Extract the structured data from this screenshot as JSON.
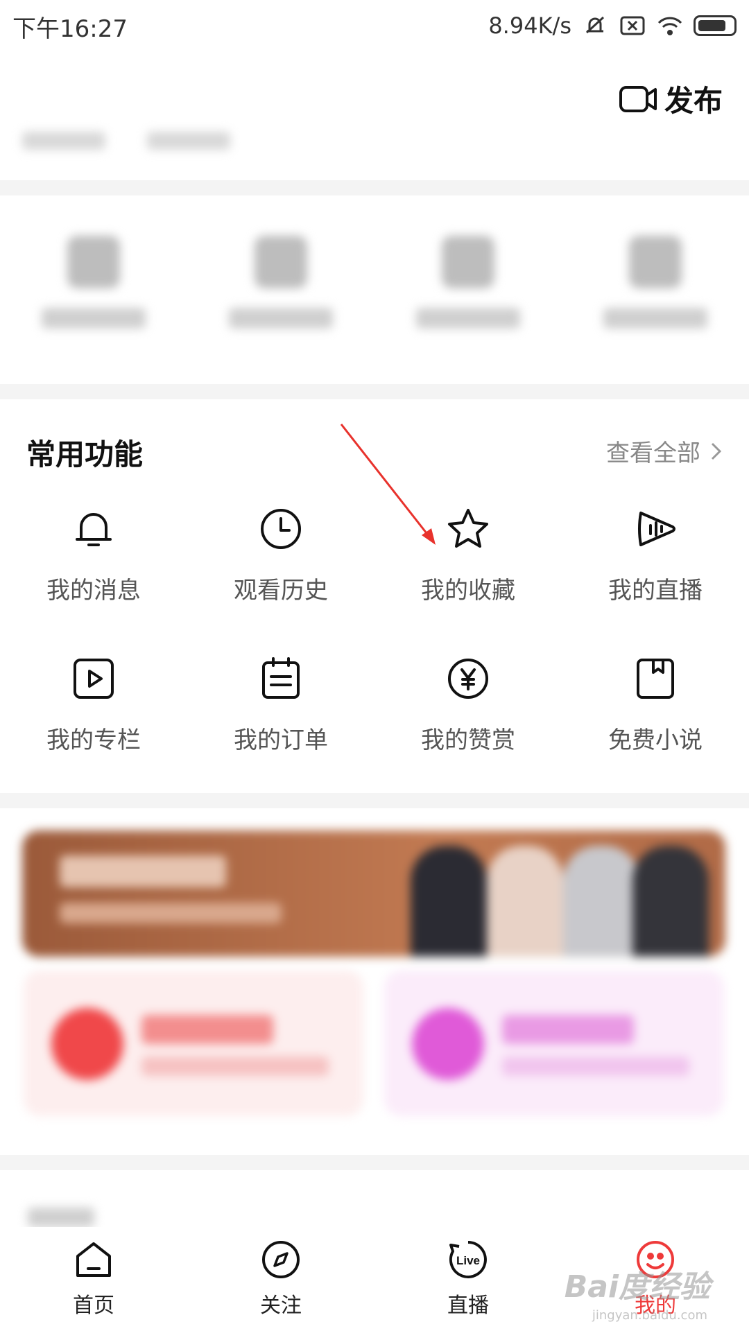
{
  "status_bar": {
    "time": "下午16:27",
    "net_speed": "8.94K/s"
  },
  "header": {
    "publish_label": "发布"
  },
  "common_functions": {
    "title": "常用功能",
    "view_all_label": "查看全部",
    "items": [
      {
        "label": "我的消息",
        "icon": "bell-icon"
      },
      {
        "label": "观看历史",
        "icon": "clock-icon"
      },
      {
        "label": "我的收藏",
        "icon": "star-icon"
      },
      {
        "label": "我的直播",
        "icon": "live-wave-icon"
      },
      {
        "label": "我的专栏",
        "icon": "play-square-icon"
      },
      {
        "label": "我的订单",
        "icon": "calendar-list-icon"
      },
      {
        "label": "我的赞赏",
        "icon": "yen-circle-icon"
      },
      {
        "label": "免费小说",
        "icon": "bookmark-book-icon"
      }
    ]
  },
  "tab_bar": {
    "tabs": [
      {
        "label": "首页",
        "icon": "home-icon",
        "active": false
      },
      {
        "label": "关注",
        "icon": "compass-icon",
        "active": false
      },
      {
        "label": "直播",
        "icon": "live-icon",
        "active": false
      },
      {
        "label": "我的",
        "icon": "profile-icon",
        "active": true
      }
    ]
  },
  "watermark": {
    "text": "Bai度经验",
    "sub": "jingyan.baidu.com"
  },
  "colors": {
    "accent": "#ee3a3a",
    "banner": "#b06a46",
    "card_left": "#fdeeee",
    "card_right": "#fbecfa",
    "annotation_arrow": "#e8322c"
  }
}
